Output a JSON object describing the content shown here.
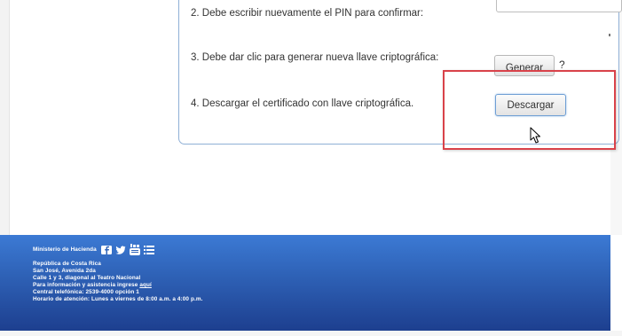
{
  "steps": {
    "step2": "2. Debe escribir nuevamente el PIN para confirmar:",
    "step3": "3. Debe dar clic para generar nueva llave criptográfica:",
    "step4": "4. Descargar el certificado con llave criptográfica."
  },
  "buttons": {
    "generar": "Generar",
    "help": "?",
    "descargar": "Descargar"
  },
  "footer": {
    "ministry": "Ministerio de Hacienda",
    "country": "República de Costa Rica",
    "city": "San José, Avenida 2da",
    "address": "Calle 1 y 3, diagonal al Teatro Nacional",
    "info_prefix": "Para información y asistencia ingrese ",
    "info_link": "aquí",
    "phone": "Central telefónica: 2539-4000 opción 1",
    "hours": "Horario de atención: Lunes a viernes de 8:00 a.m. a 4:00 p.m."
  },
  "icons": [
    "facebook-icon",
    "twitter-icon",
    "youtube-icon",
    "menu-list-icon",
    "mouse-pointer-icon"
  ],
  "colors": {
    "highlight": "#d9424a",
    "footer_top": "#3c7ad4",
    "footer_bottom": "#1d3f8f",
    "panel_border": "#8fb0d6"
  }
}
